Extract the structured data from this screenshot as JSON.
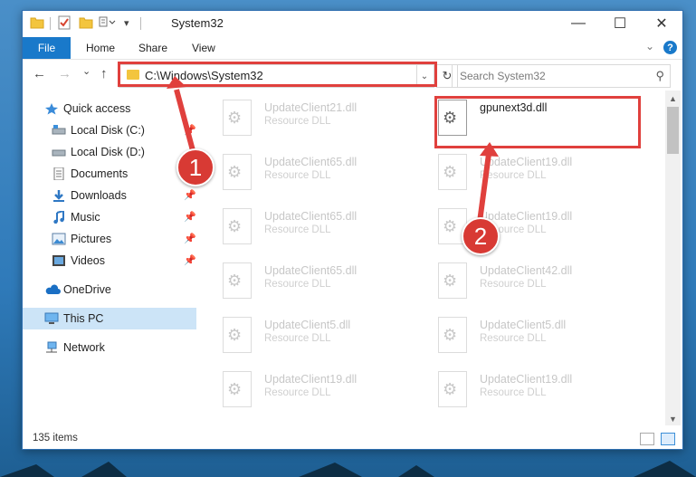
{
  "window": {
    "title": "System32",
    "minimize_glyph": "—",
    "maximize_glyph": "☐",
    "close_glyph": "✕"
  },
  "ribbon": {
    "tabs": [
      "File",
      "Home",
      "Share",
      "View"
    ],
    "help_glyph": "?",
    "expand_glyph": "⌄"
  },
  "navbar": {
    "back_glyph": "←",
    "forward_glyph": "→",
    "recent_glyph": "⌄",
    "up_glyph": "↑",
    "address": "C:\\Windows\\System32",
    "address_dropdown_glyph": "⌄",
    "refresh_glyph": "↻",
    "search_placeholder": "Search System32",
    "search_glyph": "⚲"
  },
  "sidebar": {
    "items": [
      {
        "label": "Quick access",
        "icon": "star-icon"
      },
      {
        "label": "Local Disk (C:)",
        "icon": "drive-icon"
      },
      {
        "label": "Local Disk (D:)",
        "icon": "drive-icon"
      },
      {
        "label": "Documents",
        "icon": "documents-icon"
      },
      {
        "label": "Downloads",
        "icon": "downloads-icon"
      },
      {
        "label": "Music",
        "icon": "music-icon"
      },
      {
        "label": "Pictures",
        "icon": "pictures-icon"
      },
      {
        "label": "Videos",
        "icon": "videos-icon"
      },
      {
        "label": "OneDrive",
        "icon": "cloud-icon"
      },
      {
        "label": "This PC",
        "icon": "pc-icon"
      },
      {
        "label": "Network",
        "icon": "network-icon"
      }
    ],
    "pin_glyph": "📌"
  },
  "files": [
    {
      "name": "UpdateClient21.dll",
      "type": "Resource DLL"
    },
    {
      "name": "gpunext3d.dll",
      "type": ""
    },
    {
      "name": "UpdateClient65.dll",
      "type": "Resource DLL"
    },
    {
      "name": "UpdateClient19.dll",
      "type": "Resource DLL"
    },
    {
      "name": "UpdateClient65.dll",
      "type": "Resource DLL"
    },
    {
      "name": "UpdateClient19.dll",
      "type": "Resource DLL"
    },
    {
      "name": "UpdateClient65.dll",
      "type": "Resource DLL"
    },
    {
      "name": "UpdateClient42.dll",
      "type": "Resource DLL"
    },
    {
      "name": "UpdateClient5.dll",
      "type": "Resource DLL"
    },
    {
      "name": "UpdateClient5.dll",
      "type": "Resource DLL"
    },
    {
      "name": "UpdateClient19.dll",
      "type": "Resource DLL"
    },
    {
      "name": "UpdateClient19.dll",
      "type": "Resource DLL"
    }
  ],
  "file_gear_glyph": "⚙",
  "status": {
    "item_count": "135 items"
  },
  "annotations": {
    "step1": "1",
    "step2": "2",
    "color": "#e0403d"
  },
  "scrollbar": {
    "up_glyph": "▲",
    "down_glyph": "▼"
  }
}
